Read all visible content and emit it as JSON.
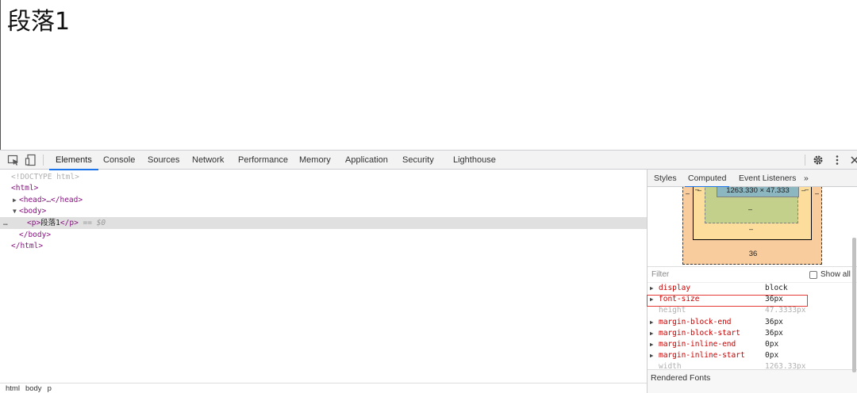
{
  "page": {
    "paragraph": "段落1"
  },
  "devtools": {
    "tabs": [
      "Elements",
      "Console",
      "Sources",
      "Network",
      "Performance",
      "Memory",
      "Application",
      "Security",
      "Lighthouse"
    ],
    "active_tab": "Elements",
    "tree": {
      "doctype": "<!DOCTYPE html>",
      "html_open": "<html>",
      "head": "<head>…</head>",
      "body_open": "<body>",
      "p_open": "<p>",
      "p_text": "段落1",
      "p_close": "</p>",
      "selected_marker": "== $0",
      "body_close": "</body>",
      "html_close": "</html>",
      "dots": "…"
    },
    "breadcrumbs": [
      "html",
      "body",
      "p"
    ],
    "sidebar": {
      "tabs": [
        "Styles",
        "Computed",
        "Event Listeners",
        "»"
      ],
      "active_tab": "Computed",
      "box_model": {
        "content": "1263.330 × 47.333",
        "dash": "–",
        "margin_bottom": "36"
      },
      "filter_placeholder": "Filter",
      "show_all": "Show all",
      "properties": [
        {
          "name": "display",
          "value": "block",
          "expandable": true,
          "inherited": false
        },
        {
          "name": "font-size",
          "value": "36px",
          "expandable": true,
          "inherited": false
        },
        {
          "name": "height",
          "value": "47.3333px",
          "expandable": false,
          "inherited": true
        },
        {
          "name": "margin-block-end",
          "value": "36px",
          "expandable": true,
          "inherited": false
        },
        {
          "name": "margin-block-start",
          "value": "36px",
          "expandable": true,
          "inherited": false
        },
        {
          "name": "margin-inline-end",
          "value": "0px",
          "expandable": true,
          "inherited": false
        },
        {
          "name": "margin-inline-start",
          "value": "0px",
          "expandable": true,
          "inherited": false
        },
        {
          "name": "width",
          "value": "1263.33px",
          "expandable": false,
          "inherited": true
        }
      ],
      "rendered_fonts": "Rendered Fonts"
    },
    "highlight_color": "#e53935",
    "accent_color": "#1a73e8"
  }
}
